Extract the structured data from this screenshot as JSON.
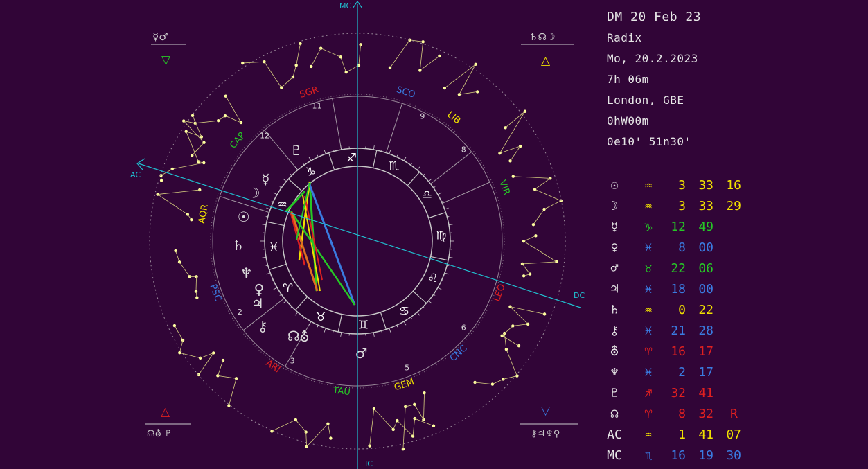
{
  "header": {
    "title": "DM 20 Feb 23",
    "chart_kind": "Radix",
    "date": "Mo, 20.2.2023",
    "time": "7h 06m",
    "place": "London, GBE",
    "timezone": "0hW00m",
    "coords": "0e10'  51n30'"
  },
  "axis_labels": {
    "mc": "MC",
    "ic": "IC",
    "ac": "AC",
    "dc": "DC"
  },
  "signs": [
    {
      "abbr": "SCO",
      "glyph": "♏",
      "color": "#3a7be0"
    },
    {
      "abbr": "LIB",
      "glyph": "♎",
      "color": "#f0e000"
    },
    {
      "abbr": "VIR",
      "glyph": "♍",
      "color": "#26c826"
    },
    {
      "abbr": "LEO",
      "glyph": "♌",
      "color": "#e02020"
    },
    {
      "abbr": "CNC",
      "glyph": "♋",
      "color": "#3a7be0"
    },
    {
      "abbr": "GEM",
      "glyph": "♊",
      "color": "#f0e000"
    },
    {
      "abbr": "TAU",
      "glyph": "♉",
      "color": "#26c826"
    },
    {
      "abbr": "ARI",
      "glyph": "♈",
      "color": "#e02020"
    },
    {
      "abbr": "PSC",
      "glyph": "♓",
      "color": "#3a7be0"
    },
    {
      "abbr": "AQR",
      "glyph": "♒",
      "color": "#f0e000"
    },
    {
      "abbr": "CAP",
      "glyph": "♑",
      "color": "#26c826"
    },
    {
      "abbr": "SGR",
      "glyph": "♐",
      "color": "#e02020"
    }
  ],
  "house_numbers": [
    "2",
    "3",
    "5",
    "6",
    "8",
    "9",
    "11",
    "12"
  ],
  "chart_planets": [
    {
      "name": "sun",
      "glyph": "☉"
    },
    {
      "name": "moon",
      "glyph": "☽"
    },
    {
      "name": "saturn",
      "glyph": "♄"
    },
    {
      "name": "pluto",
      "glyph": "♇"
    },
    {
      "name": "mercury",
      "glyph": "☿"
    },
    {
      "name": "neptune",
      "glyph": "♆"
    },
    {
      "name": "venus",
      "glyph": "♀"
    },
    {
      "name": "jupiter",
      "glyph": "♃"
    },
    {
      "name": "chiron",
      "glyph": "⚷"
    },
    {
      "name": "node",
      "glyph": "☊"
    },
    {
      "name": "uranus",
      "glyph": "⛢"
    },
    {
      "name": "mars",
      "glyph": "♂"
    }
  ],
  "corner_elements": {
    "top_left": {
      "planets": "☿♂",
      "element": "▽",
      "color": "#26c826"
    },
    "top_right": {
      "planets": "♄☊☽",
      "element": "△",
      "color": "#f0e000"
    },
    "bottom_left": {
      "planets": "☊⛢ ♇",
      "element": "△",
      "color": "#e02020"
    },
    "bottom_right": {
      "planets": "⚷♃♆♀",
      "element": "▽",
      "color": "#3a7be0"
    }
  },
  "positions": [
    {
      "planet": "☉",
      "sign": "♒",
      "deg": "3",
      "min": "33",
      "sec": "16",
      "color": "#f0e000"
    },
    {
      "planet": "☽",
      "sign": "♒",
      "deg": "3",
      "min": "33",
      "sec": "29",
      "color": "#f0e000"
    },
    {
      "planet": "☿",
      "sign": "♑",
      "deg": "12",
      "min": "49",
      "sec": "",
      "color": "#26c826"
    },
    {
      "planet": "♀",
      "sign": "♓",
      "deg": "8",
      "min": "00",
      "sec": "",
      "color": "#3a7be0"
    },
    {
      "planet": "♂",
      "sign": "♉",
      "deg": "22",
      "min": "06",
      "sec": "",
      "color": "#26c826"
    },
    {
      "planet": "♃",
      "sign": "♓",
      "deg": "18",
      "min": "00",
      "sec": "",
      "color": "#3a7be0"
    },
    {
      "planet": "♄",
      "sign": "♒",
      "deg": "0",
      "min": "22",
      "sec": "",
      "color": "#f0e000"
    },
    {
      "planet": "⚷",
      "sign": "♓",
      "deg": "21",
      "min": "28",
      "sec": "",
      "color": "#3a7be0"
    },
    {
      "planet": "⛢",
      "sign": "♈",
      "deg": "16",
      "min": "17",
      "sec": "",
      "color": "#e02020"
    },
    {
      "planet": "♆",
      "sign": "♓",
      "deg": "2",
      "min": "17",
      "sec": "",
      "color": "#3a7be0"
    },
    {
      "planet": "♇",
      "sign": "♐",
      "deg": "32",
      "min": "41",
      "sec": "",
      "color": "#e02020"
    },
    {
      "planet": "☊",
      "sign": "♈",
      "deg": "8",
      "min": "32",
      "sec": "",
      "retro": "R",
      "color": "#e02020"
    },
    {
      "planet": "AC",
      "sign": "♒",
      "deg": "1",
      "min": "41",
      "sec": "07",
      "color": "#f0e000"
    },
    {
      "planet": "MC",
      "sign": "♏",
      "deg": "16",
      "min": "19",
      "sec": "30",
      "color": "#3a7be0"
    }
  ]
}
